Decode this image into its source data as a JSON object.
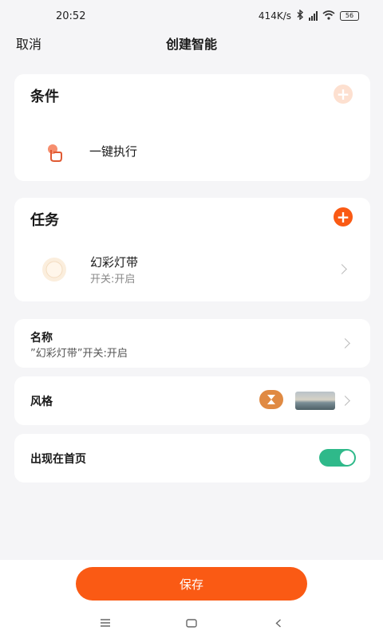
{
  "status_bar": {
    "time": "20:52",
    "net_speed": "414K/s",
    "battery": "56"
  },
  "header": {
    "cancel_label": "取消",
    "title": "创建智能"
  },
  "conditions": {
    "title": "条件",
    "item_label": "一键执行"
  },
  "tasks": {
    "title": "任务",
    "item_title": "幻彩灯带",
    "item_subtitle": "开关:开启"
  },
  "name_row": {
    "label": "名称",
    "value": "”幻彩灯带”开关:开启"
  },
  "style_row": {
    "label": "风格"
  },
  "home_row": {
    "label": "出现在首页",
    "enabled": true
  },
  "save_label": "保存",
  "colors": {
    "accent": "#fa5a14",
    "toggle_on": "#2fb98a",
    "background": "#f5f5f7"
  },
  "icons": {
    "condition": "tap-hand-icon",
    "task": "light-strip-icon",
    "style": "hourglass-icon",
    "nav": [
      "menu-icon",
      "home-icon",
      "back-icon"
    ]
  }
}
